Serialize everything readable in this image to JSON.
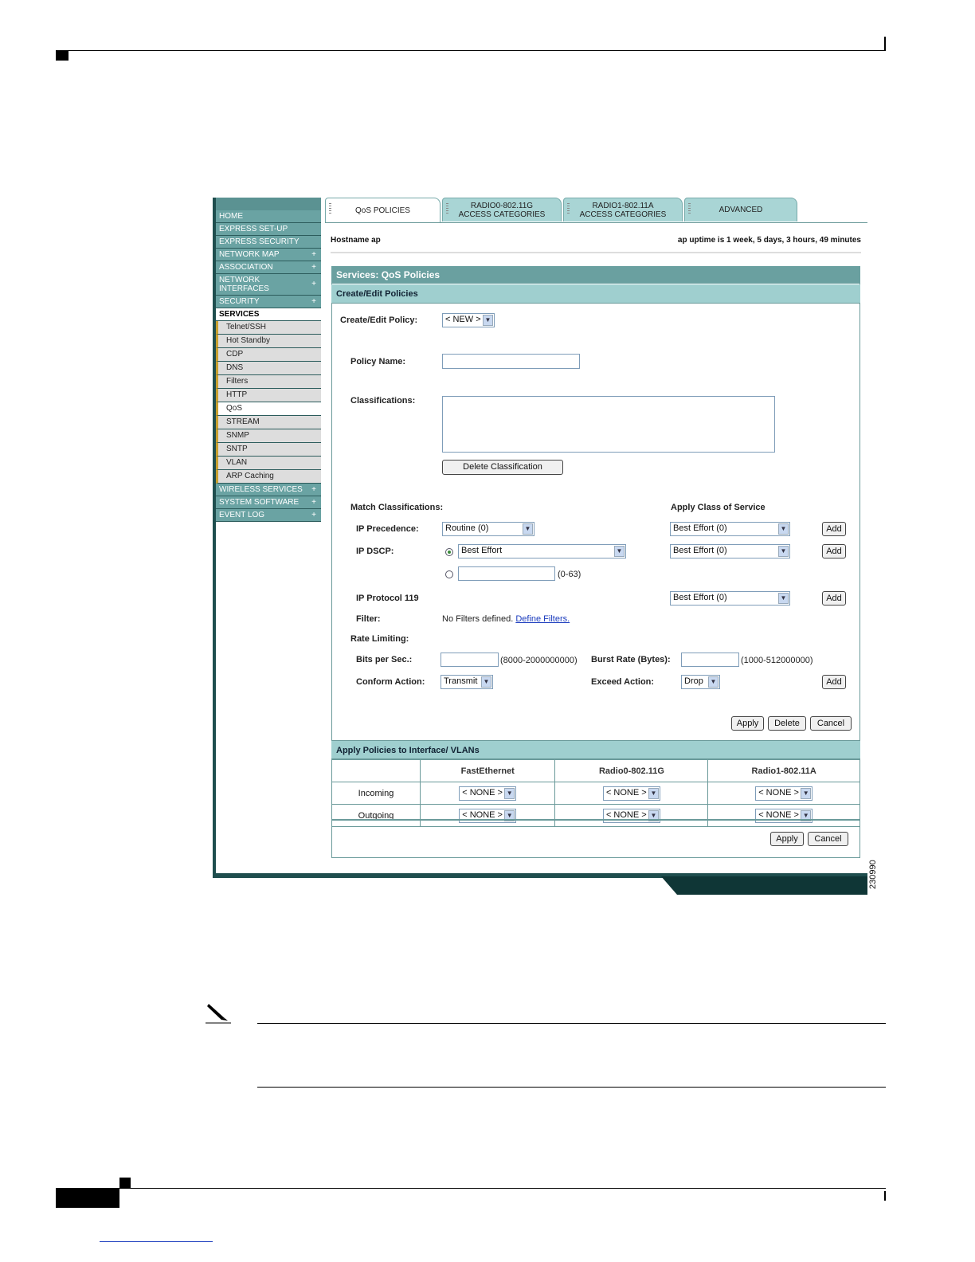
{
  "tabs": [
    {
      "label": "QoS POLICIES"
    },
    {
      "line1": "RADIO0-802.11G",
      "line2": "ACCESS CATEGORIES"
    },
    {
      "line1": "RADIO1-802.11A",
      "line2": "ACCESS CATEGORIES"
    },
    {
      "label": "ADVANCED"
    }
  ],
  "header": {
    "hostname": "Hostname  ap",
    "uptime": "ap uptime is 1 week, 5 days, 3 hours, 49 minutes"
  },
  "sidebar": {
    "items": [
      {
        "label": "HOME",
        "plus": ""
      },
      {
        "label": "EXPRESS SET-UP",
        "plus": ""
      },
      {
        "label": "EXPRESS SECURITY",
        "plus": ""
      },
      {
        "label": "NETWORK MAP",
        "plus": "+"
      },
      {
        "label": "ASSOCIATION",
        "plus": "+"
      },
      {
        "label": "NETWORK INTERFACES",
        "plus": "+"
      },
      {
        "label": "SECURITY",
        "plus": "+"
      }
    ],
    "section": "SERVICES",
    "sub_items": [
      "Telnet/SSH",
      "Hot Standby",
      "CDP",
      "DNS",
      "Filters",
      "HTTP",
      "QoS",
      "STREAM",
      "SNMP",
      "SNTP",
      "VLAN",
      "ARP Caching"
    ],
    "selected_sub": "QoS",
    "bottom_items": [
      {
        "label": "WIRELESS SERVICES",
        "plus": "+"
      },
      {
        "label": "SYSTEM SOFTWARE",
        "plus": "+"
      },
      {
        "label": "EVENT LOG",
        "plus": "+"
      }
    ]
  },
  "panel": {
    "title": "Services: QoS Policies",
    "subtitle": "Create/Edit Policies",
    "create_edit_label": "Create/Edit Policy:",
    "create_edit_value": "< NEW >",
    "policy_name_label": "Policy Name:",
    "policy_name_value": "",
    "classifications_label": "Classifications:",
    "delete_classification": "Delete Classification",
    "match_classifications": "Match Classifications:",
    "apply_cos": "Apply Class of Service",
    "ip_precedence_label": "IP Precedence:",
    "ip_precedence_value": "Routine (0)",
    "ip_dscp_label": "IP DSCP:",
    "ip_dscp_value": "Best Effort",
    "dscp_range": "(0-63)",
    "ip_protocol_label": "IP Protocol 119",
    "cos_value": "Best Effort (0)",
    "add": "Add",
    "filter_label": "Filter:",
    "filter_text": "No Filters defined.",
    "filter_link": "Define Filters.",
    "rate_limiting": "Rate Limiting:",
    "bits_label": "Bits per Sec.:",
    "bits_range": "(8000-2000000000)",
    "burst_label": "Burst Rate (Bytes):",
    "burst_range": "(1000-512000000)",
    "conform_label": "Conform Action:",
    "conform_value": "Transmit",
    "exceed_label": "Exceed Action:",
    "exceed_value": "Drop",
    "apply": "Apply",
    "delete": "Delete",
    "cancel": "Cancel"
  },
  "apply_policies": {
    "title": "Apply Policies to Interface/ VLANs",
    "columns": [
      "FastEthernet",
      "Radio0-802.11G",
      "Radio1-802.11A"
    ],
    "rows": [
      "Incoming",
      "Outgoing"
    ],
    "none_value": "< NONE >",
    "apply": "Apply",
    "cancel": "Cancel"
  },
  "figure_number": "230990"
}
